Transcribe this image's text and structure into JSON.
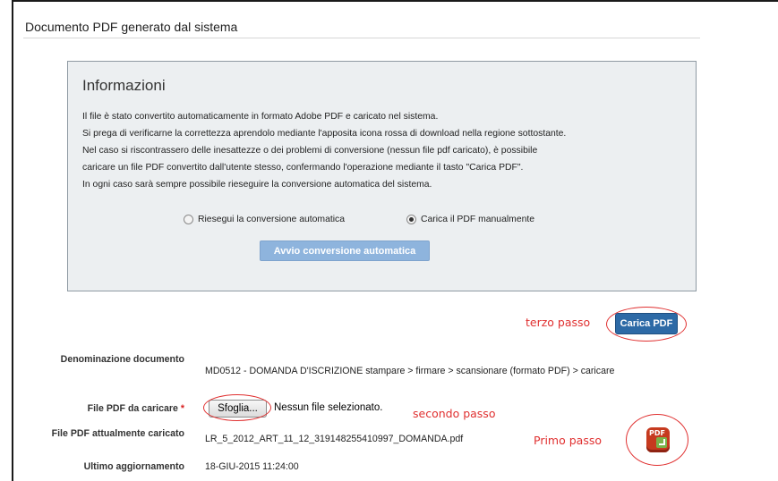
{
  "section": {
    "title": "Documento PDF generato dal sistema"
  },
  "info": {
    "title": "Informazioni",
    "lines": [
      "Il file è stato convertito automaticamente in formato Adobe PDF e caricato nel sistema.",
      "Si prega di verificarne la correttezza aprendolo mediante l'apposita icona rossa di download nella regione sottostante.",
      "Nel caso si riscontrassero delle inesattezze o dei problemi di conversione (nessun file pdf caricato), è possibile",
      "caricare un file PDF convertito dall'utente stesso, confermando l'operazione mediante il tasto \"Carica PDF\".",
      "In ogni caso sarà sempre possibile rieseguire la conversione automatica del sistema."
    ],
    "options": [
      {
        "label": "Riesegui la conversione automatica",
        "selected": false
      },
      {
        "label": "Carica il PDF manualmente",
        "selected": true
      }
    ],
    "auto_button": "Avvio conversione automatica"
  },
  "annotations": {
    "step3": "terzo passo",
    "step2": "secondo passo",
    "step1": "Primo passo",
    "color": "#e03030"
  },
  "carica_button": "Carica PDF",
  "form": {
    "denominazione_label": "Denominazione documento",
    "denominazione_value": "MD0512 - DOMANDA D'ISCRIZIONE stampare > firmare > scansionare (formato PDF) > caricare",
    "file_label": "File PDF da caricare",
    "required_mark": "*",
    "browse_button": "Sfoglia...",
    "no_file": "Nessun file selezionato.",
    "current_label": "File PDF attualmente caricato",
    "current_value": "LR_5_2012_ART_11_12_319148255410997_DOMANDA.pdf",
    "updated_label": "Ultimo aggiornamento",
    "updated_value": "18-GIU-2015 11:24:00"
  },
  "icons": {
    "download": "pdf-download-icon"
  },
  "colors": {
    "primary_button": "#2d6aa6",
    "disabled_button": "#8eb4dd",
    "pdf_icon": "#c63a1f"
  }
}
